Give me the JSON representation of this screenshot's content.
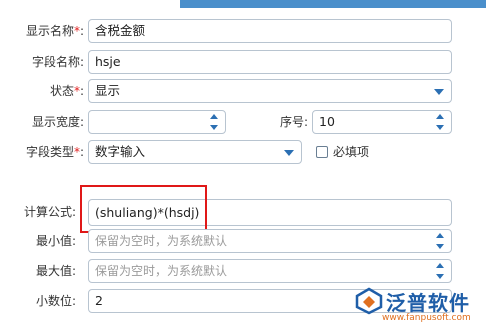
{
  "form": {
    "display_name": {
      "label": "显示名称",
      "required": "*",
      "colon": ":",
      "value": "含税金额"
    },
    "field_name": {
      "label": "字段名称:",
      "value": "hsje"
    },
    "status": {
      "label": "状态",
      "required": "*",
      "colon": ":",
      "value": "显示"
    },
    "display_width": {
      "label": "显示宽度:",
      "value": ""
    },
    "sequence": {
      "label": "序号:",
      "value": "10"
    },
    "field_type": {
      "label": "字段类型",
      "required": "*",
      "colon": ":",
      "value": "数字输入"
    },
    "required_checkbox": {
      "label": "必填项",
      "checked": false
    },
    "formula": {
      "label": "计算公式:",
      "value": "(shuliang)*(hsdj)"
    },
    "min_value": {
      "label": "最小值:",
      "placeholder": "保留为空时，为系统默认"
    },
    "max_value": {
      "label": "最大值:",
      "placeholder": "保留为空时，为系统默认"
    },
    "decimals": {
      "label": "小数位:",
      "value": "2"
    }
  },
  "watermark": {
    "brand": "泛普软件",
    "url": "www.fanpusoft.com"
  },
  "colors": {
    "accent": "#4a8fcb",
    "highlight": "#e01818",
    "required": "#e02020",
    "brand": "#1f5ea8"
  }
}
